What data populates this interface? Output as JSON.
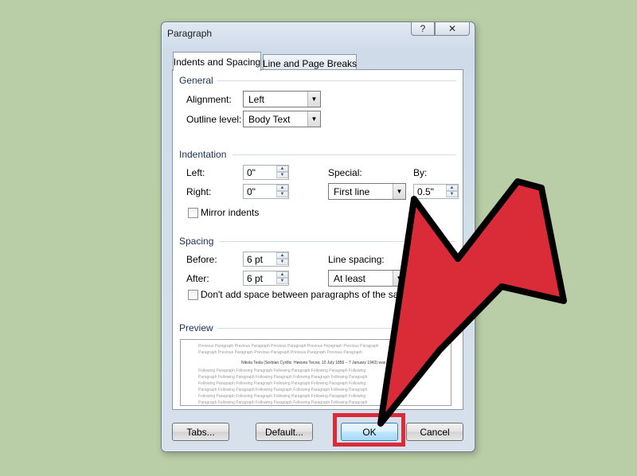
{
  "dialog": {
    "title": "Paragraph",
    "help_label": "?",
    "close_label": "✕"
  },
  "tabs": [
    {
      "label": "Indents and Spacing",
      "active": true
    },
    {
      "label": "Line and Page Breaks",
      "active": false
    }
  ],
  "general": {
    "header": "General",
    "alignment_label": "Alignment:",
    "alignment_value": "Left",
    "outline_label": "Outline level:",
    "outline_value": "Body Text"
  },
  "indentation": {
    "header": "Indentation",
    "left_label": "Left:",
    "left_value": "0\"",
    "right_label": "Right:",
    "right_value": "0\"",
    "special_label": "Special:",
    "special_value": "First line",
    "by_label": "By:",
    "by_value": "0.5\"",
    "mirror_label": "Mirror indents",
    "mirror_checked": false
  },
  "spacing": {
    "header": "Spacing",
    "before_label": "Before:",
    "before_value": "6 pt",
    "after_label": "After:",
    "after_value": "6 pt",
    "line_spacing_label": "Line spacing:",
    "line_spacing_value": "At least",
    "dont_add_label": "Don't add space between paragraphs of the same st",
    "dont_add_checked": false
  },
  "preview": {
    "header": "Preview",
    "previous_lines": [
      "Previous Paragraph Previous Paragraph Previous Paragraph Previous Paragraph Previous Paragraph",
      "Paragraph Previous Paragraph Previous Paragraph Previous Paragraph Previous Paragraph"
    ],
    "sample_text": "Nikola Tesla (Serbian Cyrillic: Никола Тесла; 10 July 1856 – 7 January 1943) was a",
    "following_lines": [
      "Following Paragraph Following Paragraph Following Paragraph Following Paragraph Following",
      "Paragraph Following Paragraph Following Paragraph Following Paragraph Following Paragraph",
      "Following Paragraph Following Paragraph Following Paragraph Following Paragraph Following",
      "Paragraph Following Paragraph Following Paragraph Following Paragraph Following Paragraph",
      "Following Paragraph Following Paragraph Following Paragraph Following Paragraph Following",
      "Paragraph Following Paragraph Following Paragraph Following Paragraph Following Paragraph"
    ]
  },
  "buttons": {
    "tabs": "Tabs...",
    "default": "Default...",
    "ok": "OK",
    "cancel": "Cancel"
  },
  "colors": {
    "background": "#b9cda6",
    "highlight": "#d92b38",
    "arrow_fill": "#d92b38",
    "arrow_stroke": "#000000"
  }
}
